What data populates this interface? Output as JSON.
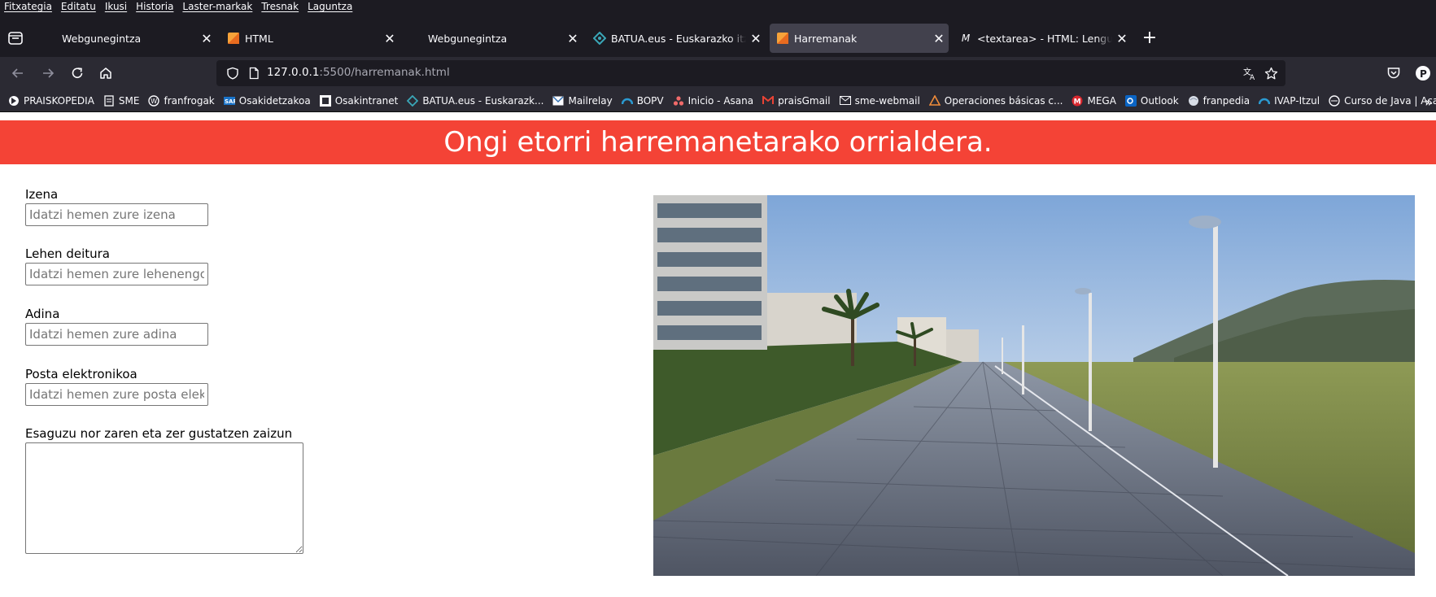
{
  "menubar": {
    "items": [
      "Fitxategia",
      "Editatu",
      "Ikusi",
      "Historia",
      "Laster-markak",
      "Tresnak",
      "Laguntza"
    ]
  },
  "tabs": [
    {
      "title": "Webgunegintza",
      "favicon": "none",
      "selected": false
    },
    {
      "title": "HTML",
      "favicon": "orange-square-icon",
      "selected": false
    },
    {
      "title": "Webgunegintza",
      "favicon": "none",
      "selected": false
    },
    {
      "title": "BATUA.eus - Euskarazko itzultzailea",
      "favicon": "batua-icon",
      "selected": false
    },
    {
      "title": "Harremanak",
      "favicon": "orange-square-icon",
      "selected": true
    },
    {
      "title": "<textarea> - HTML: Lenguaje de",
      "favicon": "mdn-icon",
      "selected": false
    }
  ],
  "navbar": {
    "url_host": "127.0.0.1",
    "url_rest": ":5500/harremanak.html"
  },
  "bookmarks": [
    {
      "label": "PRAISKOPEDIA",
      "icon": "praiskopedia-icon"
    },
    {
      "label": "SME",
      "icon": "sme-icon"
    },
    {
      "label": "franfrogak",
      "icon": "wordpress-icon"
    },
    {
      "label": "Osakidetzakoa",
      "icon": "sap-icon"
    },
    {
      "label": "Osakintranet",
      "icon": "osakintranet-icon"
    },
    {
      "label": "BATUA.eus - Euskarazk...",
      "icon": "batua-icon"
    },
    {
      "label": "Mailrelay",
      "icon": "mail-icon"
    },
    {
      "label": "BOPV",
      "icon": "bopv-icon"
    },
    {
      "label": "Inicio - Asana",
      "icon": "asana-icon"
    },
    {
      "label": "praisGmail",
      "icon": "gmail-icon"
    },
    {
      "label": "sme-webmail",
      "icon": "envelope-icon"
    },
    {
      "label": "Operaciones básicas c...",
      "icon": "triangle-icon"
    },
    {
      "label": "MEGA",
      "icon": "mega-icon"
    },
    {
      "label": "Outlook",
      "icon": "outlook-icon"
    },
    {
      "label": "franpedia",
      "icon": "globe-icon"
    },
    {
      "label": "IVAP-Itzul",
      "icon": "ivap-icon"
    },
    {
      "label": "Curso de Java | Acade...",
      "icon": "java-icon"
    }
  ],
  "page": {
    "heading": "Ongi etorri harremanetarako orrialdera.",
    "header_color": "#f44336",
    "fields": {
      "izena": {
        "label": "Izena",
        "placeholder": "Idatzi hemen zure izena"
      },
      "deitura": {
        "label": "Lehen deitura",
        "placeholder": "Idatzi hemen zure lehenengo deitura"
      },
      "adina": {
        "label": "Adina",
        "placeholder": "Idatzi hemen zure adina"
      },
      "posta": {
        "label": "Posta elektronikoa",
        "placeholder": "Idatzi hemen zure posta elektronikoa"
      },
      "iruzkina": {
        "label": "Esaguzu nor zaren eta zer gustatzen zaizun"
      }
    }
  }
}
